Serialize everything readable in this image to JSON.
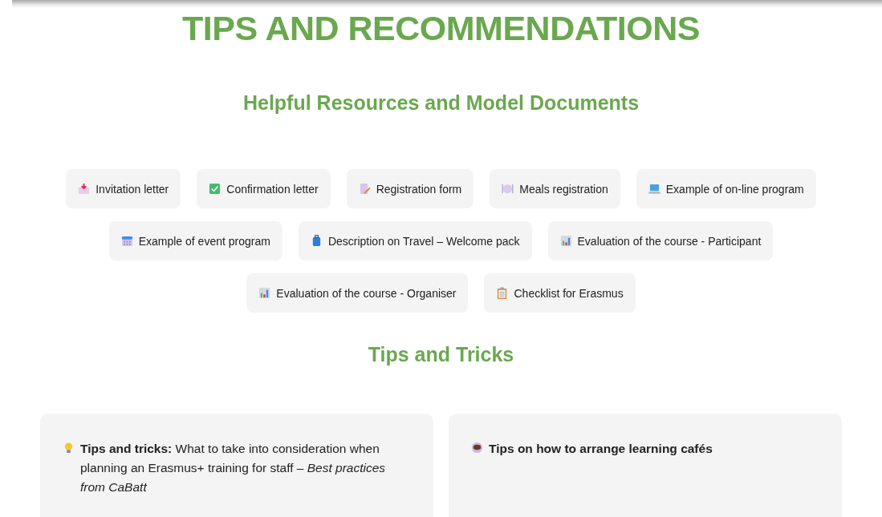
{
  "title": "TIPS AND RECOMMENDATIONS",
  "resources": {
    "heading": "Helpful Resources and Model Documents",
    "items": [
      {
        "label": "Invitation letter",
        "kind": "envelope"
      },
      {
        "label": "Confirmation letter",
        "kind": "check"
      },
      {
        "label": "Registration form",
        "kind": "memo"
      },
      {
        "label": "Meals registration",
        "kind": "plate"
      },
      {
        "label": "Example of on-line program",
        "kind": "laptop"
      },
      {
        "label": "Example of event program",
        "kind": "calendar"
      },
      {
        "label": "Description on Travel – Welcome pack",
        "kind": "luggage"
      },
      {
        "label": "Evaluation of the course - Participant",
        "kind": "chart"
      },
      {
        "label": "Evaluation of the course - Organiser",
        "kind": "chart"
      },
      {
        "label": "Checklist for Erasmus",
        "kind": "clipboard"
      }
    ]
  },
  "tips": {
    "heading": "Tips and Tricks",
    "cards": [
      {
        "kind": "note",
        "text": "**Tips and tricks:** What to take into consideration when planning an Erasmus+ training for staff – *Best practices from CaBatt*"
      },
      {
        "kind": "title",
        "text": "Tips on how to arrange learning cafés"
      }
    ]
  }
}
